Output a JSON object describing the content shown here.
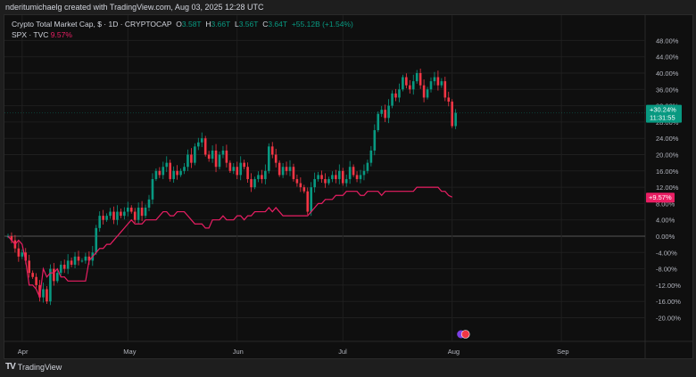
{
  "credit": "nderitumichaelg created with TradingView.com, Aug 03, 2025 12:28 UTC",
  "legend": {
    "main": "Crypto Total Market Cap, $ · 1D · CRYPTOCAP",
    "o_label": "O",
    "o": "3.58T",
    "h_label": "H",
    "h": "3.66T",
    "l_label": "L",
    "l": "3.56T",
    "c_label": "C",
    "c": "3.64T",
    "change": "+55.12B (+1.54%)",
    "spx": "SPX · TVC",
    "spx_value": "9.57%"
  },
  "footer": {
    "brand": "TradingView",
    "logo": "TV"
  },
  "colors": {
    "up": "#089981",
    "down": "#f23645",
    "spx": "#e91e63",
    "grid": "#1f1f1f",
    "text": "#b2b5be"
  },
  "chart_data": {
    "type": "candlestick+line",
    "start_date": "2025-03-28",
    "ylabel": "percent change",
    "ylim": [
      -22,
      48
    ],
    "yticks": [
      48,
      44,
      40,
      36,
      32,
      28,
      24,
      20,
      16,
      12,
      8,
      4,
      0,
      -4,
      -8,
      -12,
      -16,
      -20
    ],
    "xticks": [
      {
        "label": "Apr",
        "day": 4
      },
      {
        "label": "May",
        "day": 34
      },
      {
        "label": "Jun",
        "day": 65
      },
      {
        "label": "Jul",
        "day": 95
      },
      {
        "label": "Aug",
        "day": 126
      },
      {
        "label": "Sep",
        "day": 157
      }
    ],
    "grid": true,
    "series": [
      {
        "name": "Crypto Total Market Cap",
        "kind": "candles",
        "last_label": "+30.24%",
        "countdown": "11:31:55",
        "closes": [
          0,
          -1,
          -3,
          -5,
          -4,
          -6,
          -9,
          -10,
          -12,
          -15,
          -13,
          -16,
          -8,
          -11,
          -9,
          -7,
          -8,
          -6,
          -7,
          -5,
          -6,
          -6,
          -5,
          -6,
          -4,
          2,
          5,
          4,
          5,
          6,
          4,
          6,
          5,
          6,
          7,
          6,
          4,
          7,
          5,
          7,
          9,
          14,
          16,
          15,
          17,
          18,
          14,
          16,
          15,
          16,
          17,
          20,
          18,
          22,
          23,
          24,
          20,
          19,
          21,
          17,
          20,
          21,
          18,
          16,
          17,
          15,
          18,
          17,
          14,
          12,
          14,
          15,
          14,
          16,
          22,
          20,
          18,
          15,
          17,
          16,
          17,
          14,
          13,
          12,
          11,
          6,
          12,
          14,
          15,
          14,
          13,
          14,
          15,
          14,
          16,
          13,
          14,
          17,
          15,
          14,
          15,
          16,
          18,
          21,
          26,
          30,
          31,
          29,
          32,
          35,
          34,
          36,
          39,
          37,
          36,
          38,
          40,
          37,
          34,
          36,
          38,
          39,
          37,
          38,
          34,
          33,
          27,
          30.24
        ]
      },
      {
        "name": "SPX",
        "kind": "line",
        "last_label": "+9.57%",
        "values": [
          0,
          -1,
          -2,
          -1,
          -2,
          -6,
          -12,
          -12,
          -13,
          -15,
          -8,
          -10,
          -9,
          -9,
          -8,
          -10,
          -10,
          -11,
          -11,
          -11,
          -11,
          -11,
          -11,
          -6,
          -5,
          -4,
          -3,
          -3,
          -2,
          -2,
          -1,
          0,
          1,
          2,
          3,
          4,
          3,
          3,
          3,
          4,
          4,
          4,
          4,
          5,
          6,
          6,
          5,
          5,
          6,
          6,
          6,
          5,
          4,
          3,
          3,
          3,
          2,
          2,
          4,
          4,
          4,
          5,
          4,
          4,
          4,
          5,
          5,
          4,
          5,
          5,
          6,
          6,
          6,
          6,
          7,
          6,
          7,
          6,
          5,
          5,
          5,
          5,
          5,
          5,
          5,
          5,
          6,
          7,
          8,
          8,
          9,
          9,
          9,
          10,
          10,
          10,
          11,
          11,
          11,
          11,
          10,
          10,
          11,
          11,
          11,
          11,
          10,
          11,
          11,
          11,
          11,
          11,
          11,
          11,
          11,
          11,
          12,
          12,
          12,
          12,
          12,
          12,
          12,
          11,
          11,
          10,
          9.57
        ]
      }
    ]
  }
}
